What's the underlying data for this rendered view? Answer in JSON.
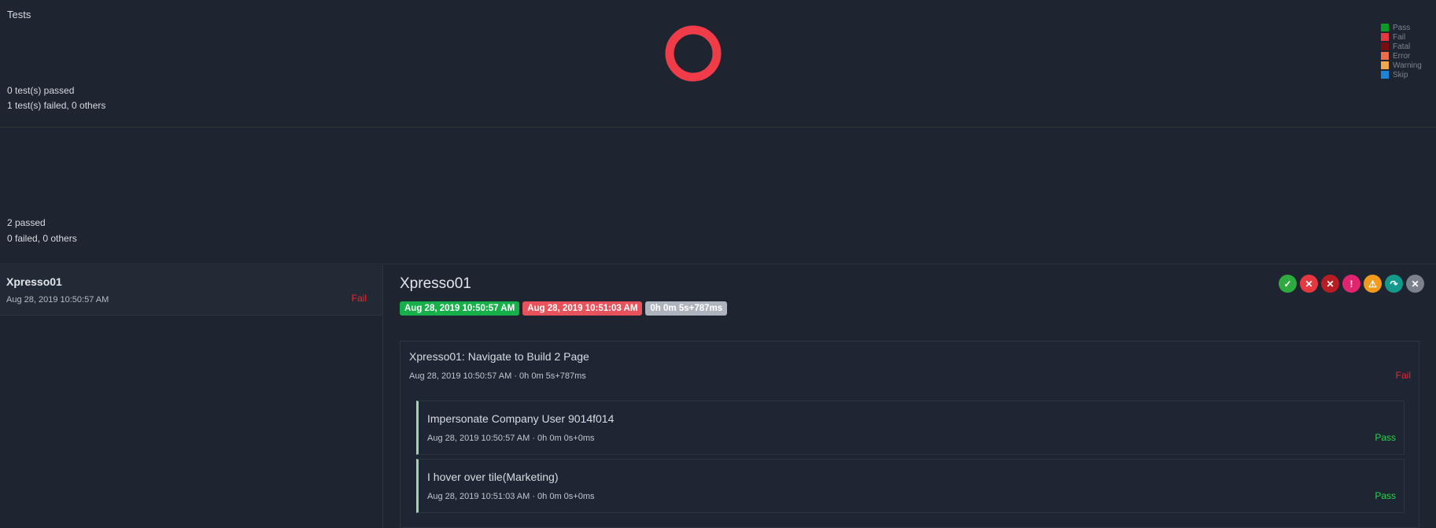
{
  "summary": {
    "title": "Tests",
    "passed_text": "0 test(s) passed",
    "failed_text": "1 test(s) failed, 0 others",
    "chart_data": {
      "type": "pie",
      "categories": [
        "Pass",
        "Fail",
        "Fatal",
        "Error",
        "Warning",
        "Skip"
      ],
      "values": [
        0,
        1,
        0,
        0,
        0,
        0
      ],
      "colors": [
        "#0a9b28",
        "#f03c48",
        "#7a0d0d",
        "#ef6c4a",
        "#f2a847",
        "#1e84d6"
      ]
    },
    "legend": [
      {
        "label": "Pass",
        "color": "#0a9b28"
      },
      {
        "label": "Fail",
        "color": "#e8383f"
      },
      {
        "label": "Fatal",
        "color": "#7a0d0d"
      },
      {
        "label": "Error",
        "color": "#ef6c4a"
      },
      {
        "label": "Warning",
        "color": "#f2a847"
      },
      {
        "label": "Skip",
        "color": "#1e84d6"
      }
    ]
  },
  "summary2": {
    "passed_text": "2 passed",
    "failed_text": "0 failed, 0 others"
  },
  "test_list": [
    {
      "name": "Xpresso01",
      "time": "Aug 28, 2019 10:50:57 AM",
      "status": "Fail"
    }
  ],
  "detail": {
    "title": "Xpresso01",
    "start": "Aug 28, 2019 10:50:57 AM",
    "end": "Aug 28, 2019 10:51:03 AM",
    "duration": "0h 0m 5s+787ms",
    "filters": [
      {
        "name": "pass-filter-icon",
        "glyph": "✓",
        "color": "#2eaa3f"
      },
      {
        "name": "fail-filter-icon",
        "glyph": "✕",
        "color": "#e8383f"
      },
      {
        "name": "fatal-filter-icon",
        "glyph": "✕",
        "color": "#b81d24"
      },
      {
        "name": "error-filter-icon",
        "glyph": "!",
        "color": "#e0246e"
      },
      {
        "name": "warning-filter-icon",
        "glyph": "⚠",
        "color": "#f29a1a"
      },
      {
        "name": "skip-filter-icon",
        "glyph": "↷",
        "color": "#149a8a"
      },
      {
        "name": "clear-filter-icon",
        "glyph": "✕",
        "color": "#7c828b"
      }
    ],
    "step": {
      "name": "Xpresso01: Navigate to Build 2 Page",
      "meta": "Aug 28, 2019 10:50:57 AM · 0h 0m 5s+787ms",
      "status": "Fail",
      "nodes": [
        {
          "name": "Impersonate Company User 9014f014",
          "meta": "Aug 28, 2019 10:50:57 AM · 0h 0m 0s+0ms",
          "status": "Pass"
        },
        {
          "name": "I hover over tile(Marketing)",
          "meta": "Aug 28, 2019 10:51:03 AM · 0h 0m 0s+0ms",
          "status": "Pass"
        }
      ]
    }
  }
}
